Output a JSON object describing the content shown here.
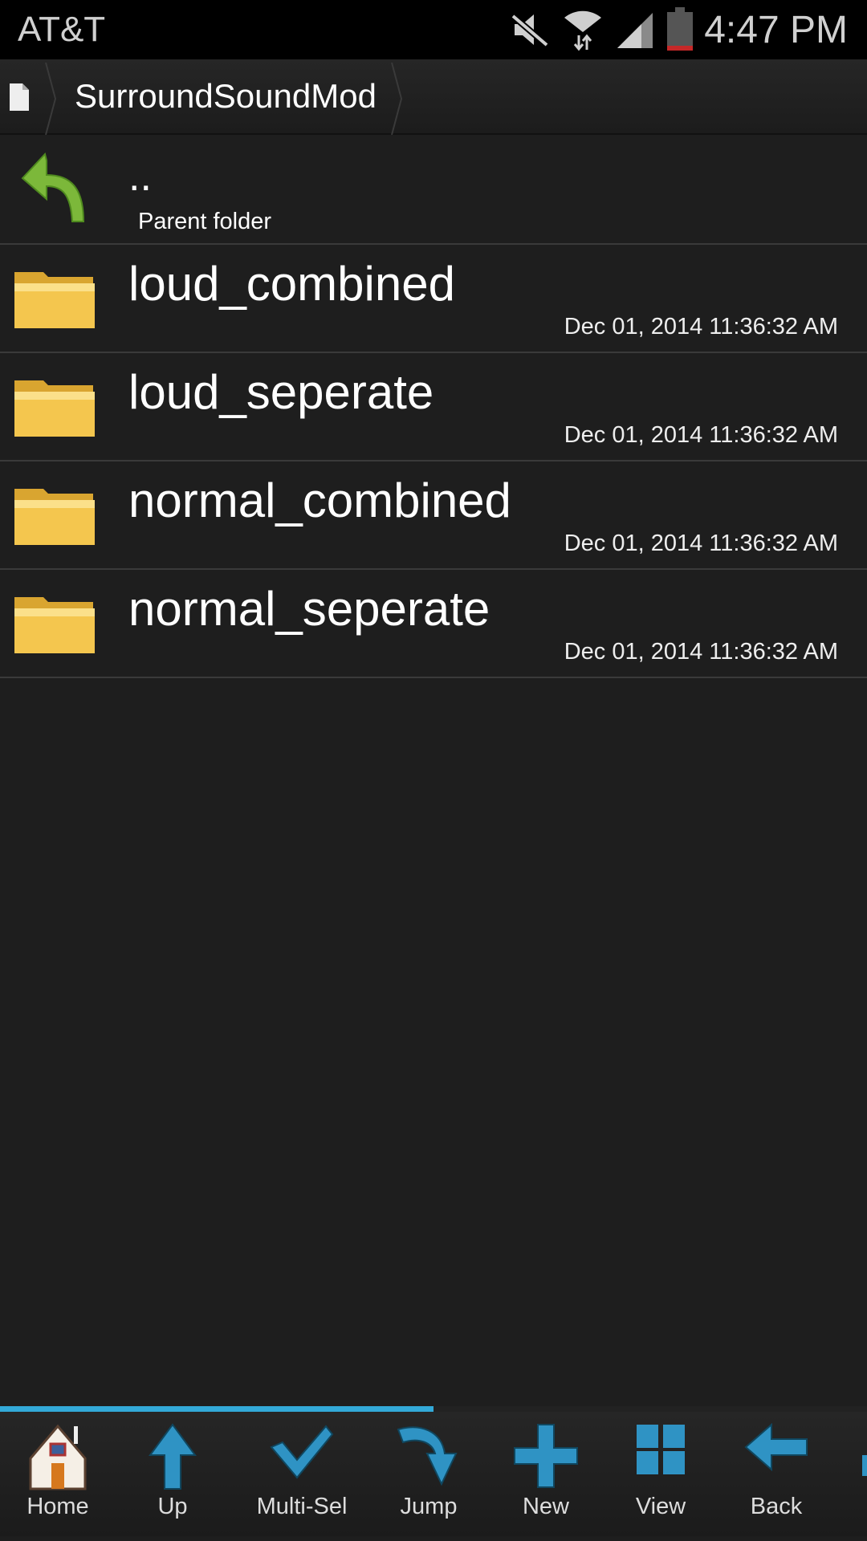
{
  "status_bar": {
    "carrier": "AT&T",
    "time": "4:47 PM",
    "icons": [
      "mute-icon",
      "wifi-icon",
      "signal-icon",
      "battery-low-icon"
    ]
  },
  "breadcrumb": {
    "root_icon": "file-icon",
    "path": [
      "SurroundSoundMod"
    ]
  },
  "parent": {
    "name": "..",
    "label": "Parent folder"
  },
  "items": [
    {
      "name": "loud_combined",
      "date": "Dec 01, 2014 11:36:32 AM"
    },
    {
      "name": "loud_seperate",
      "date": "Dec 01, 2014 11:36:32 AM"
    },
    {
      "name": "normal_combined",
      "date": "Dec 01, 2014 11:36:32 AM"
    },
    {
      "name": "normal_seperate",
      "date": "Dec 01, 2014 11:36:32 AM"
    }
  ],
  "scroll_progress": 0.5,
  "toolbar": [
    {
      "label": "Home",
      "icon": "home-icon"
    },
    {
      "label": "Up",
      "icon": "arrow-up-icon"
    },
    {
      "label": "Multi-Sel",
      "icon": "checkmark-icon"
    },
    {
      "label": "Jump",
      "icon": "jump-arrow-icon"
    },
    {
      "label": "New",
      "icon": "plus-icon"
    },
    {
      "label": "View",
      "icon": "grid-view-icon"
    },
    {
      "label": "Back",
      "icon": "arrow-left-icon"
    }
  ],
  "colors": {
    "accent": "#33a9d8",
    "folder": "#f2c44a",
    "parent_arrow": "#7cb83a"
  }
}
